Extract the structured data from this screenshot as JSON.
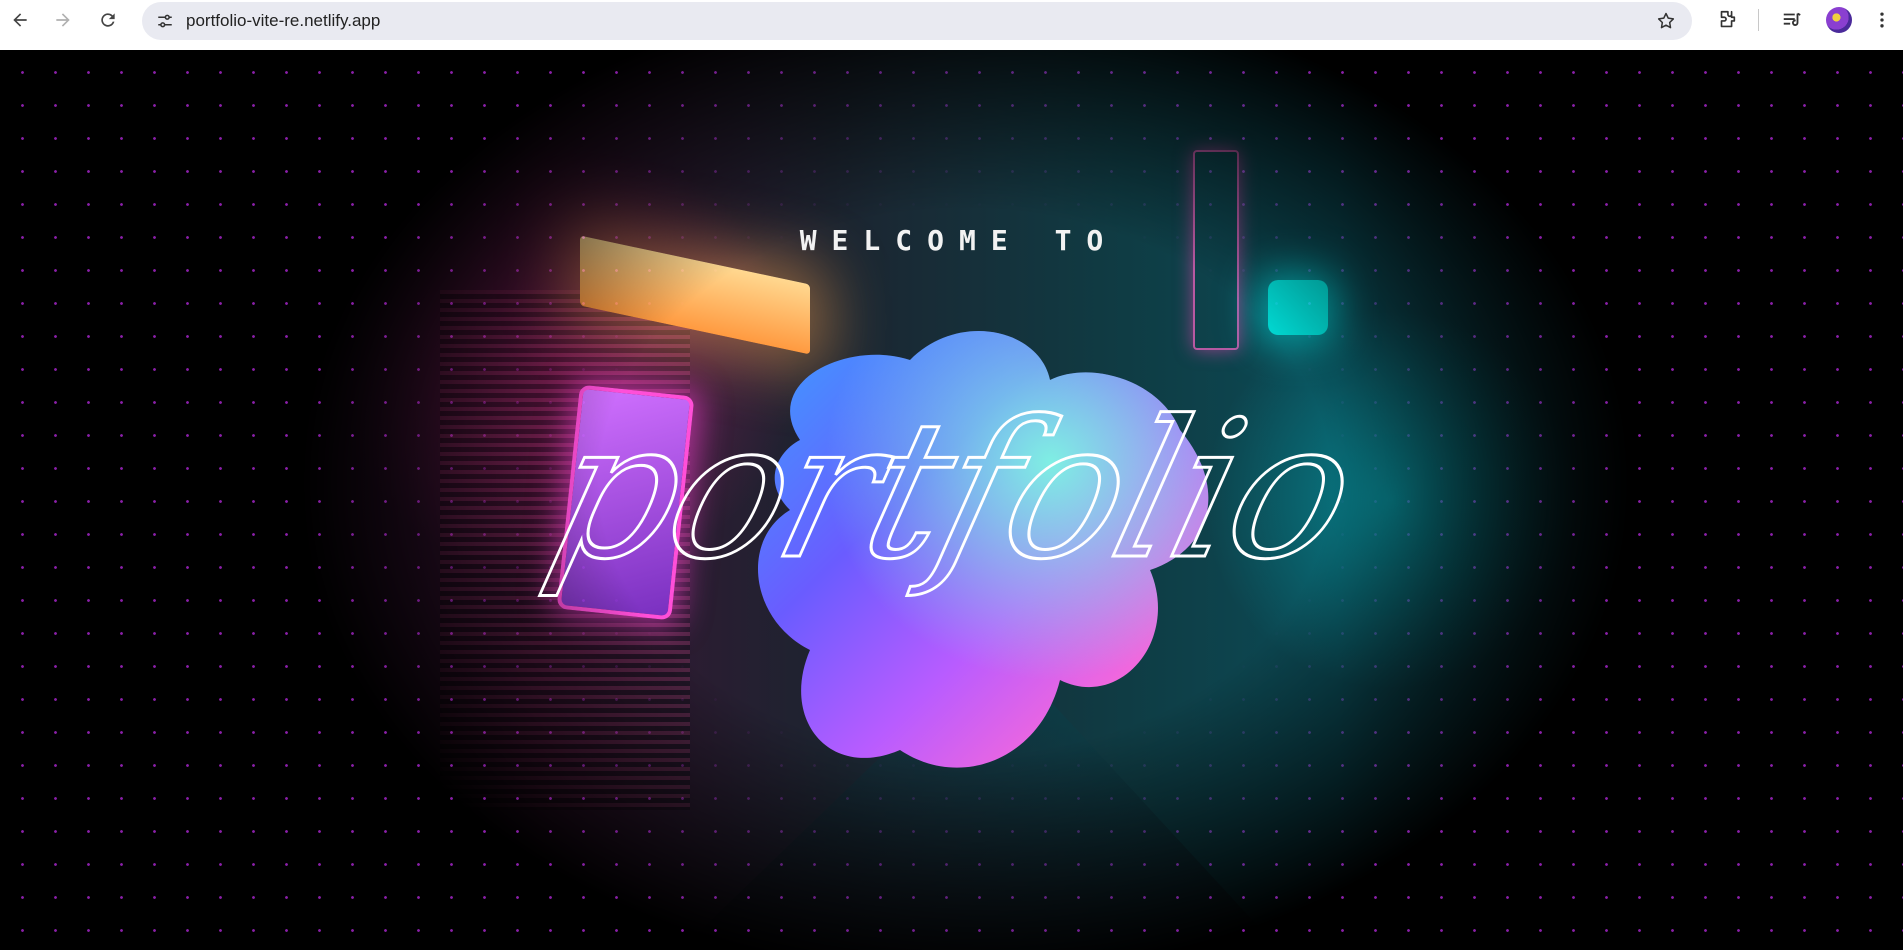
{
  "browser": {
    "url": "portfolio-vite-re.netlify.app"
  },
  "hero": {
    "eyebrow": "WELCOME TO",
    "title": "portfolio"
  },
  "colors": {
    "dot": "#8a1fa8",
    "neon_pink": "#ff4fd8",
    "neon_cyan": "#00f0e6",
    "text": "#f2f2f2"
  }
}
